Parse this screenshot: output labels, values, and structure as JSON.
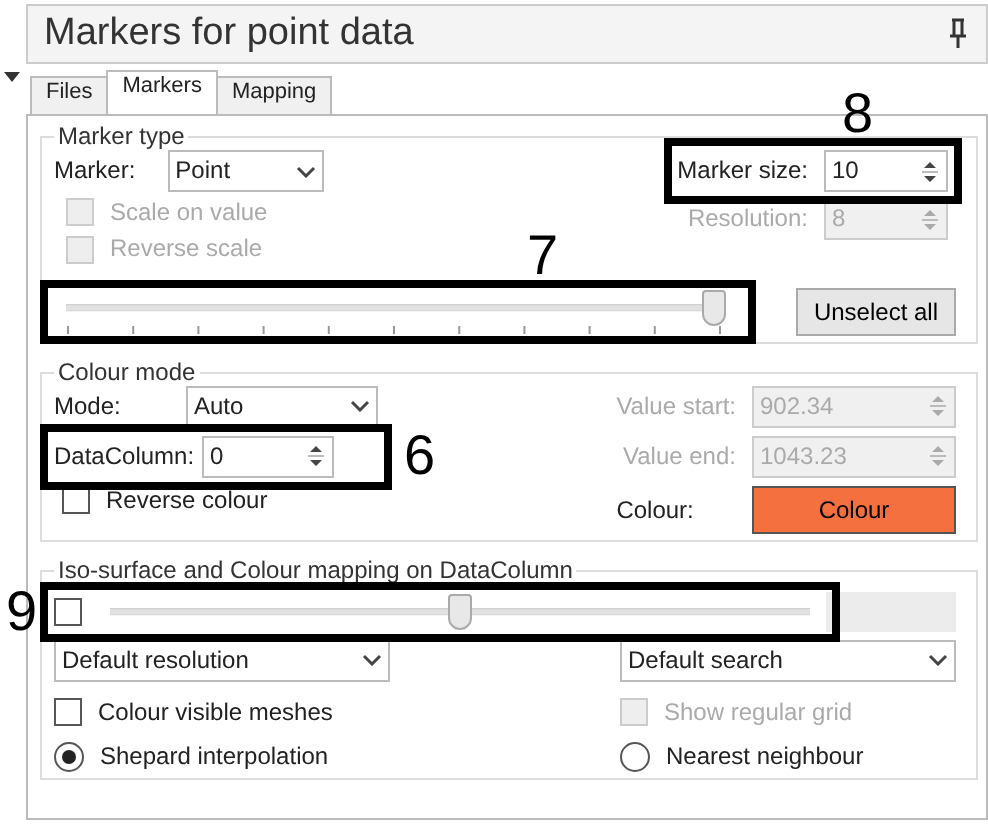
{
  "window": {
    "title": "Markers for point data"
  },
  "tabs": [
    {
      "label": "Files",
      "selected": false
    },
    {
      "label": "Markers",
      "selected": true
    },
    {
      "label": "Mapping",
      "selected": false
    }
  ],
  "marker_type": {
    "title": "Marker type",
    "marker_label": "Marker:",
    "marker_value": "Point",
    "size_label": "Marker size:",
    "size_value": "10",
    "options": [
      {
        "label": "Scale on value",
        "checked": false,
        "disabled": true
      },
      {
        "label": "Reverse scale",
        "checked": false,
        "disabled": true
      }
    ],
    "resolution": {
      "label": "Resolution:",
      "value": "8",
      "disabled": true
    },
    "slider": {
      "level": 1.0
    },
    "button": "Unselect all"
  },
  "colour_mode": {
    "title": "Colour mode",
    "mode_label": "Mode:",
    "mode_value": "Auto",
    "column_label": "DataColumn:",
    "column_value": "0",
    "value_start": {
      "label": "Value start:",
      "value": "902.34",
      "disabled": true
    },
    "value_end": {
      "label": "Value end:",
      "value": "1043.23",
      "disabled": true
    },
    "reverse": {
      "label": "Reverse colour",
      "checked": false,
      "disabled": false
    },
    "colour_label": "Colour:",
    "colour_button": {
      "label": "Colour",
      "color": "#f5703f"
    }
  },
  "iso": {
    "title": "Iso-surface and Colour mapping on DataColumn",
    "enabled": {
      "checked": false
    },
    "slider": {
      "level": 0.5
    },
    "resolution_value": "Default resolution",
    "search_value": "Default search",
    "checks": [
      {
        "label": "Colour visible meshes",
        "checked": false,
        "disabled": false
      },
      {
        "label": "Show regular grid",
        "checked": false,
        "disabled": true
      }
    ],
    "radios": [
      {
        "label": "Shepard interpolation",
        "selected": true
      },
      {
        "label": "Nearest neighbour",
        "selected": false
      }
    ]
  },
  "callouts": [
    {
      "label": "8",
      "kind": "size"
    },
    {
      "label": "7",
      "kind": "slider"
    },
    {
      "label": "6",
      "kind": "column"
    },
    {
      "label": "9",
      "kind": "iso"
    }
  ]
}
